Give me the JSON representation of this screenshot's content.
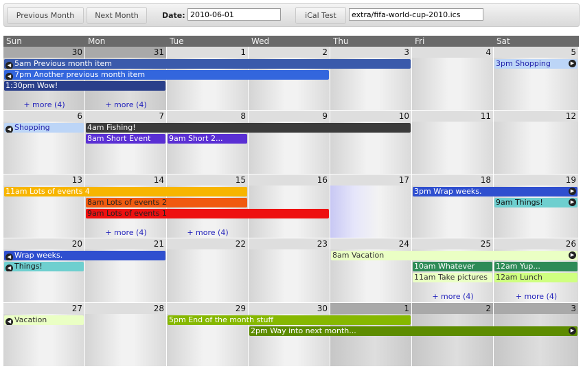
{
  "toolbar": {
    "prev_label": "Previous Month",
    "next_label": "Next Month",
    "date_label": "Date:",
    "date_value": "2010-06-01",
    "ical_label": "iCal Test",
    "ical_value": "extra/fifa-world-cup-2010.ics"
  },
  "weekdays": [
    "Sun",
    "Mon",
    "Tue",
    "Wed",
    "Thu",
    "Fri",
    "Sat"
  ],
  "weeks": [
    [
      "30",
      "31",
      "1",
      "2",
      "3",
      "4",
      "5"
    ],
    [
      "6",
      "7",
      "8",
      "9",
      "10",
      "11",
      "12"
    ],
    [
      "13",
      "14",
      "15",
      "16",
      "17",
      "18",
      "19"
    ],
    [
      "20",
      "21",
      "22",
      "23",
      "24",
      "25",
      "26"
    ],
    [
      "27",
      "28",
      "29",
      "30",
      "1",
      "2",
      "3"
    ]
  ],
  "events": [
    {
      "text": "5am Previous month item",
      "week": 0,
      "slot": 0,
      "start": 0,
      "end": 4,
      "bg": "#3a5aab",
      "fg": "#ffffff",
      "left": true
    },
    {
      "text": "7pm Another previous month item",
      "week": 0,
      "slot": 1,
      "start": 0,
      "end": 3,
      "bg": "#3366dd",
      "fg": "#ffffff",
      "left": true
    },
    {
      "text": "1:30pm Wow!",
      "week": 0,
      "slot": 2,
      "start": 0,
      "end": 1,
      "bg": "#2a3f8a",
      "fg": "#ffffff"
    },
    {
      "text": "3pm Shopping",
      "week": 0,
      "slot": 0,
      "start": 6,
      "end": 6,
      "bg": "#bcd5f7",
      "fg": "#2222aa",
      "right": true
    },
    {
      "text": "Shopping",
      "week": 1,
      "slot": 0,
      "start": 0,
      "end": 0,
      "bg": "#bcd5f7",
      "fg": "#2222aa",
      "left": true
    },
    {
      "text": "4am Fishing!",
      "week": 1,
      "slot": 0,
      "start": 1,
      "end": 4,
      "bg": "#3b3b3b",
      "fg": "#ffffff"
    },
    {
      "text": "8am Short Event",
      "week": 1,
      "slot": 1,
      "start": 1,
      "end": 1,
      "bg": "#5a2fd4",
      "fg": "#ffffff"
    },
    {
      "text": "9am Short 2...",
      "week": 1,
      "slot": 1,
      "start": 2,
      "end": 2,
      "bg": "#5a2fd4",
      "fg": "#ffffff"
    },
    {
      "text": "11am Lots of events 4",
      "week": 2,
      "slot": 0,
      "start": 0,
      "end": 2,
      "bg": "#f7b500",
      "fg": "#ffffff"
    },
    {
      "text": "8am Lots of events 2",
      "week": 2,
      "slot": 1,
      "start": 1,
      "end": 2,
      "bg": "#f05a0f",
      "fg": "#222222"
    },
    {
      "text": "9am Lots of events 1",
      "week": 2,
      "slot": 2,
      "start": 1,
      "end": 3,
      "bg": "#ee1010",
      "fg": "#222222"
    },
    {
      "text": "3pm Wrap weeks.",
      "week": 2,
      "slot": 0,
      "start": 5,
      "end": 6,
      "bg": "#2f4fcf",
      "fg": "#ffffff",
      "right": true
    },
    {
      "text": "9am Things!",
      "week": 2,
      "slot": 1,
      "start": 6,
      "end": 6,
      "bg": "#6ecfcf",
      "fg": "#111111",
      "right": true
    },
    {
      "text": "Wrap weeks.",
      "week": 3,
      "slot": 0,
      "start": 0,
      "end": 1,
      "bg": "#2f4fcf",
      "fg": "#ffffff",
      "left": true
    },
    {
      "text": "Things!",
      "week": 3,
      "slot": 1,
      "start": 0,
      "end": 0,
      "bg": "#6ecfcf",
      "fg": "#111111",
      "left": true
    },
    {
      "text": "8am Vacation",
      "week": 3,
      "slot": 0,
      "start": 4,
      "end": 6,
      "bg": "#eaffc4",
      "fg": "#333333",
      "right": true
    },
    {
      "text": "10am Whatever",
      "week": 3,
      "slot": 1,
      "start": 5,
      "end": 5,
      "bg": "#2e8b57",
      "fg": "#ffffff"
    },
    {
      "text": "12am Yup...",
      "week": 3,
      "slot": 1,
      "start": 6,
      "end": 6,
      "bg": "#2e8b57",
      "fg": "#ffffff"
    },
    {
      "text": "11am Take pictures",
      "week": 3,
      "slot": 2,
      "start": 5,
      "end": 5,
      "bg": "#eaffc4",
      "fg": "#333333"
    },
    {
      "text": "12am Lunch",
      "week": 3,
      "slot": 2,
      "start": 6,
      "end": 6,
      "bg": "#cfff80",
      "fg": "#333333"
    },
    {
      "text": "Vacation",
      "week": 4,
      "slot": 0,
      "start": 0,
      "end": 0,
      "bg": "#eaffc4",
      "fg": "#333333",
      "left": true
    },
    {
      "text": "5pm End of the month stuff",
      "week": 4,
      "slot": 0,
      "start": 2,
      "end": 4,
      "bg": "#86b800",
      "fg": "#ffffff"
    },
    {
      "text": "2pm Way into next month...",
      "week": 4,
      "slot": 1,
      "start": 3,
      "end": 6,
      "bg": "#5d8c00",
      "fg": "#ffffff",
      "right": true
    }
  ],
  "more": [
    {
      "text": "+ more (4)",
      "week": 0,
      "day": 0
    },
    {
      "text": "+ more (4)",
      "week": 0,
      "day": 1
    },
    {
      "text": "+ more (4)",
      "week": 2,
      "day": 1
    },
    {
      "text": "+ more (4)",
      "week": 2,
      "day": 2
    },
    {
      "text": "+ more (4)",
      "week": 3,
      "day": 5
    },
    {
      "text": "+ more (4)",
      "week": 3,
      "day": 6
    }
  ]
}
